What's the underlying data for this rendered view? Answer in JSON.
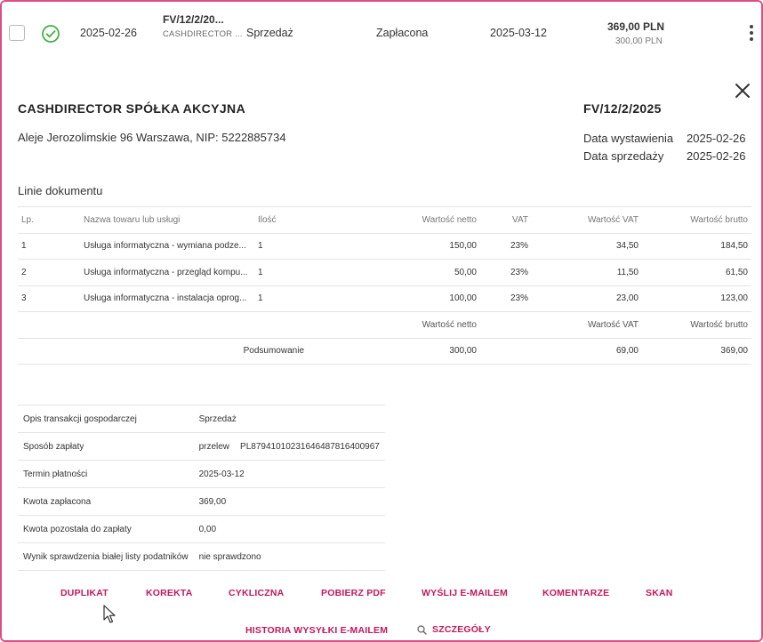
{
  "row": {
    "date_issued": "2025-02-26",
    "doc_number_short": "FV/12/2/20...",
    "contractor_short": "CASHDIRECTOR ...",
    "type": "Sprzedaż",
    "status": "Zapłacona",
    "due_date": "2025-03-12",
    "gross": "369,00 PLN",
    "net": "300,00 PLN",
    "status_color": "#43b047"
  },
  "details": {
    "company_name": "CASHDIRECTOR SPÓŁKA AKCYJNA",
    "address": "Aleje Jerozolimskie 96 Warszawa, NIP: 5222885734",
    "doc_number": "FV/12/2/2025",
    "issue_label": "Data wystawienia",
    "issue_value": "2025-02-26",
    "sale_label": "Data sprzedaży",
    "sale_value": "2025-02-26",
    "lines_title": "Linie dokumentu"
  },
  "lines": {
    "headers": [
      "Lp.",
      "Nazwa towaru lub usługi",
      "Ilość",
      "Wartość netto",
      "VAT",
      "Wartość VAT",
      "Wartość brutto"
    ],
    "rows": [
      [
        "1",
        "Usługa informatyczna - wymiana podze...",
        "1",
        "150,00",
        "23%",
        "34,50",
        "184,50"
      ],
      [
        "2",
        "Usługa informatyczna - przegląd kompu...",
        "1",
        "50,00",
        "23%",
        "11,50",
        "61,50"
      ],
      [
        "3",
        "Usługa informatyczna - instalacja oprog...",
        "1",
        "100,00",
        "23%",
        "23,00",
        "123,00"
      ]
    ],
    "summary_headers": [
      "Wartość netto",
      "Wartość VAT",
      "Wartość brutto"
    ],
    "summary_label": "Podsumowanie",
    "summary_values": [
      "300,00",
      "69,00",
      "369,00"
    ]
  },
  "info": [
    {
      "label": "Opis transakcji gospodarczej",
      "value": "Sprzedaż",
      "extra": ""
    },
    {
      "label": "Sposób zapłaty",
      "value": "przelew",
      "extra": "PL87941010231646487816400967"
    },
    {
      "label": "Termin płatności",
      "value": "2025-03-12",
      "extra": ""
    },
    {
      "label": "Kwota zapłacona",
      "value": "369,00",
      "extra": ""
    },
    {
      "label": "Kwota pozostała do zapłaty",
      "value": "0,00",
      "extra": ""
    },
    {
      "label": "Wynik sprawdzenia białej listy podatników",
      "value": "nie sprawdzono",
      "extra": ""
    }
  ],
  "actions": {
    "duplikat": "DUPLIKAT",
    "korekta": "KOREKTA",
    "cykliczna": "CYKLICZNA",
    "pobierz_pdf": "POBIERZ PDF",
    "wyslij": "WYŚLIJ E-MAILEM",
    "komentarze": "KOMENTARZE",
    "skan": "SKAN",
    "historia": "HISTORIA WYSYŁKI E-MAILEM",
    "szczegoly": "SZCZEGÓŁY"
  },
  "colors": {
    "accent": "#c2185b",
    "frame": "#d94f86",
    "paid_icon": "#43b047"
  }
}
